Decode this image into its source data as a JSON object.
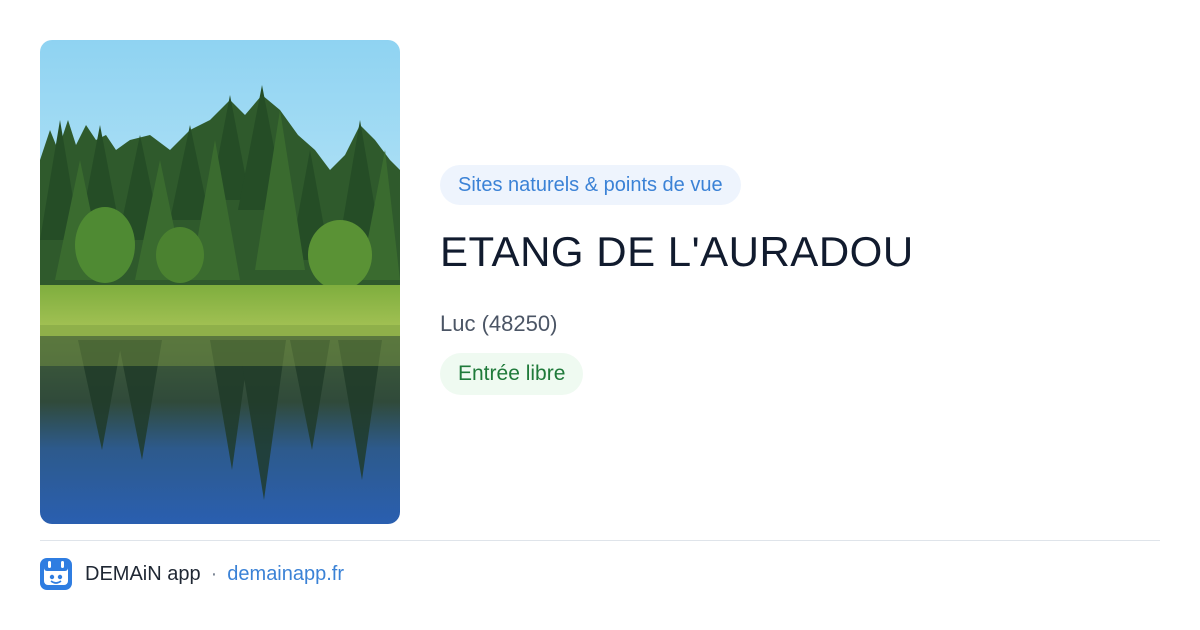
{
  "place": {
    "category": "Sites naturels & points de vue",
    "name": "ETANG DE L'AURADOU",
    "location": "Luc (48250)",
    "access": "Entrée libre",
    "photo_icon": "lake-forest-photo"
  },
  "footer": {
    "app_name": "DEMAiN app",
    "separator": "·",
    "link_text": "demainapp.fr",
    "logo_icon": "demain-app-logo-icon"
  },
  "colors": {
    "category_text": "#3b82d6",
    "category_bg": "#eef4fd",
    "access_text": "#1f7a3a",
    "access_bg": "#effaf1",
    "title": "#111b2e",
    "link": "#3b82d6"
  }
}
